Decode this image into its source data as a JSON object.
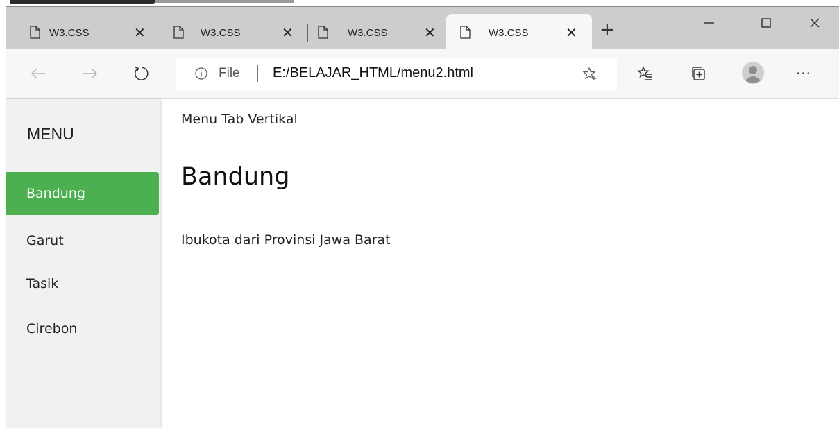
{
  "browser": {
    "tabs": [
      {
        "title": "W3.CSS",
        "close": "✕"
      },
      {
        "title": "W3.CSS",
        "close": "✕"
      },
      {
        "title": "W3.CSS",
        "close": "✕"
      },
      {
        "title": "W3.CSS",
        "close": "✕",
        "active": true
      }
    ],
    "new_tab": "+",
    "window_controls": {
      "minimize": "—",
      "maximize": "☐",
      "close": "✕"
    },
    "nav": {
      "back": "←",
      "forward": "→",
      "refresh": "↻"
    },
    "address": {
      "prefix": "File",
      "url": "E:/BELAJAR_HTML/menu2.html"
    },
    "toolbar_icons": [
      "favorites-star-icon",
      "favorites-list-icon",
      "collections-icon",
      "profile-avatar-icon",
      "more-icon"
    ],
    "more": "···"
  },
  "sidebar": {
    "title": "MENU",
    "items": [
      {
        "label": "Bandung",
        "active": true
      },
      {
        "label": "Garut"
      },
      {
        "label": "Tasik"
      },
      {
        "label": "Cirebon"
      }
    ],
    "accent": "#4caf50"
  },
  "main": {
    "subtitle": "Menu Tab Vertikal",
    "heading": "Bandung",
    "description": "Ibukota dari Provinsi Jawa Barat"
  }
}
